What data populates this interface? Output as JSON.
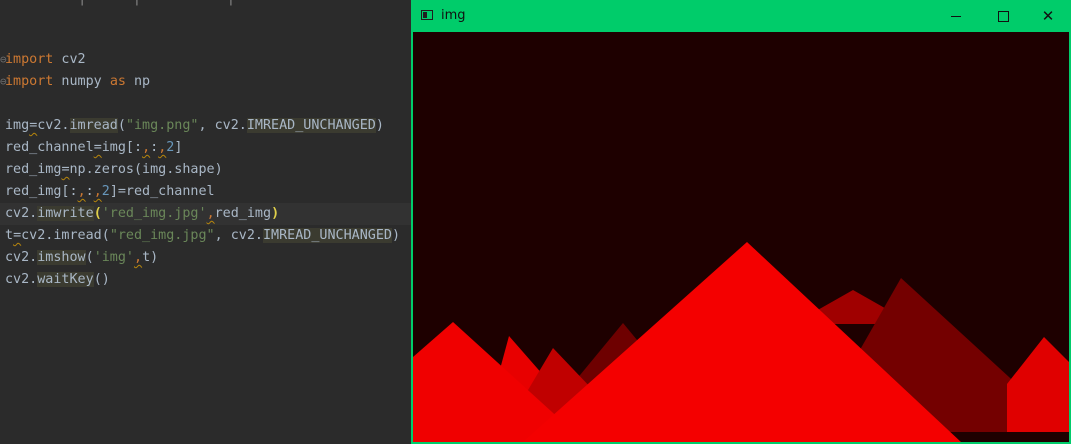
{
  "editor": {
    "cut_off_text": "          |      |           |",
    "lines": [
      {
        "gutter": "",
        "segments": []
      },
      {
        "gutter": "⊖",
        "segments": [
          {
            "t": "import",
            "c": "kw"
          },
          {
            "t": " cv2",
            "c": ""
          }
        ]
      },
      {
        "gutter": "⊖",
        "segments": [
          {
            "t": "import",
            "c": "kw"
          },
          {
            "t": " numpy ",
            "c": ""
          },
          {
            "t": "as",
            "c": "kw"
          },
          {
            "t": " np",
            "c": ""
          }
        ]
      },
      {
        "gutter": "",
        "segments": []
      },
      {
        "gutter": "",
        "segments": [
          {
            "t": "img",
            "c": ""
          },
          {
            "t": "=",
            "c": "sq"
          },
          {
            "t": "cv2.",
            "c": ""
          },
          {
            "t": "imread",
            "c": "hl"
          },
          {
            "t": "(",
            "c": ""
          },
          {
            "t": "\"img.png\"",
            "c": "str"
          },
          {
            "t": ", cv2.",
            "c": ""
          },
          {
            "t": "IMREAD_UNCHANGED",
            "c": "hl"
          },
          {
            "t": ")",
            "c": ""
          }
        ]
      },
      {
        "gutter": "",
        "segments": [
          {
            "t": "red_channel",
            "c": ""
          },
          {
            "t": "=",
            "c": "sq"
          },
          {
            "t": "img[:",
            "c": ""
          },
          {
            "t": ",",
            "c": "comma sq"
          },
          {
            "t": ":",
            "c": ""
          },
          {
            "t": ",",
            "c": "comma sq"
          },
          {
            "t": "2",
            "c": "num"
          },
          {
            "t": "]",
            "c": ""
          }
        ]
      },
      {
        "gutter": "",
        "segments": [
          {
            "t": "red_img",
            "c": ""
          },
          {
            "t": "=",
            "c": "sq"
          },
          {
            "t": "np.zeros(img.shape)",
            "c": ""
          }
        ]
      },
      {
        "gutter": "",
        "segments": [
          {
            "t": "red_img[:",
            "c": ""
          },
          {
            "t": ",",
            "c": "comma sq"
          },
          {
            "t": ":",
            "c": ""
          },
          {
            "t": ",",
            "c": "comma sq"
          },
          {
            "t": "2",
            "c": "num"
          },
          {
            "t": "]=red_channel",
            "c": ""
          }
        ]
      },
      {
        "gutter": "",
        "current": true,
        "segments": [
          {
            "t": "cv2.",
            "c": ""
          },
          {
            "t": "imwrite",
            "c": "hl"
          },
          {
            "t": "(",
            "c": "paren-match"
          },
          {
            "t": "'red_img.jpg'",
            "c": "str"
          },
          {
            "t": ",",
            "c": "comma sq"
          },
          {
            "t": "red_img",
            "c": ""
          },
          {
            "t": ")",
            "c": "paren-match"
          }
        ]
      },
      {
        "gutter": "",
        "segments": [
          {
            "t": "t",
            "c": ""
          },
          {
            "t": "=",
            "c": "sq"
          },
          {
            "t": "cv2.imread(",
            "c": ""
          },
          {
            "t": "\"red_img.jpg\"",
            "c": "str"
          },
          {
            "t": ", cv2.",
            "c": ""
          },
          {
            "t": "IMREAD_UNCHANGED",
            "c": "hl"
          },
          {
            "t": ")",
            "c": ""
          }
        ]
      },
      {
        "gutter": "",
        "segments": [
          {
            "t": "cv2.",
            "c": ""
          },
          {
            "t": "imshow",
            "c": "hl"
          },
          {
            "t": "(",
            "c": ""
          },
          {
            "t": "'img'",
            "c": "str"
          },
          {
            "t": ",",
            "c": "comma sq"
          },
          {
            "t": "t)",
            "c": ""
          }
        ]
      },
      {
        "gutter": "",
        "segments": [
          {
            "t": "cv2.",
            "c": ""
          },
          {
            "t": "waitKey",
            "c": "hl"
          },
          {
            "t": "()",
            "c": ""
          }
        ]
      }
    ]
  },
  "image_window": {
    "title": "img",
    "icon": "window-app-icon",
    "controls": {
      "minimize": "minimize-icon",
      "maximize": "maximize-icon",
      "close": "close-icon",
      "close_glyph": "✕"
    },
    "titlebar_color": "#00cc6a",
    "background_color": "#1e0000"
  }
}
